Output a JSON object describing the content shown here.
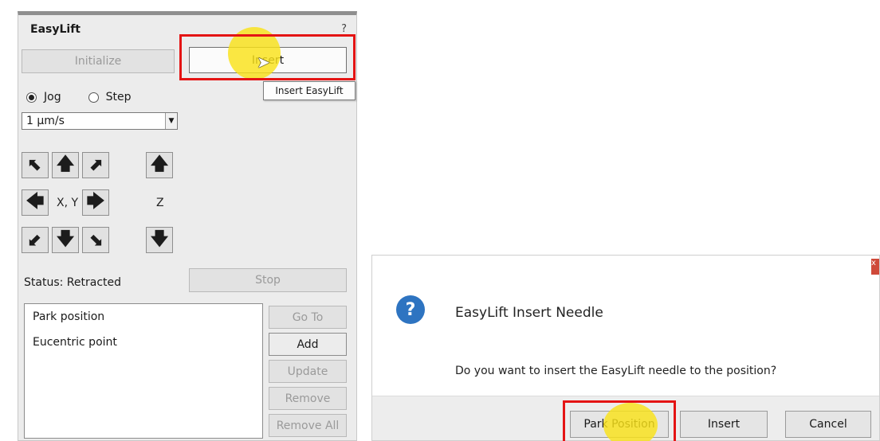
{
  "panel": {
    "title": "EasyLift",
    "help": "?",
    "initialize_label": "Initialize",
    "insert_label": "Insert",
    "tooltip": "Insert EasyLift",
    "jog_label": "Jog",
    "step_label": "Step",
    "speed_value": "1 µm/s",
    "xy_label": "X, Y",
    "z_label": "Z",
    "status_text": "Status: Retracted",
    "stop_label": "Stop",
    "positions": [
      "Park position",
      "Eucentric point"
    ],
    "goto_label": "Go To",
    "add_label": "Add",
    "update_label": "Update",
    "remove_label": "Remove",
    "remove_all_label": "Remove All"
  },
  "dialog": {
    "title": "EasyLift Insert Needle",
    "message": "Do you want to insert the EasyLift needle to the position?",
    "park_label": "Park Position",
    "insert_label": "Insert",
    "cancel_label": "Cancel",
    "close_label": "x"
  },
  "icons": {
    "up_left": "arrow-up-left-icon",
    "up": "arrow-up-icon",
    "up_right": "arrow-up-right-icon",
    "left": "arrow-left-icon",
    "right": "arrow-right-icon",
    "down_left": "arrow-down-left-icon",
    "down": "arrow-down-icon",
    "down_right": "arrow-down-right-icon",
    "question": "question-icon",
    "cursor": "mouse-cursor-icon"
  },
  "colors": {
    "highlight_red": "#e41414",
    "halo_yellow": "#f9e218",
    "dialog_icon_blue": "#2e74c1"
  }
}
